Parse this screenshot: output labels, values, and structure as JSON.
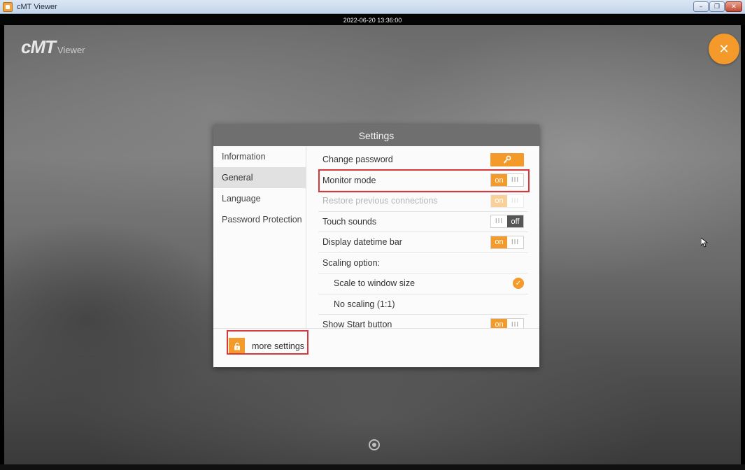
{
  "window": {
    "title": "cMT Viewer",
    "minimize_glyph": "–",
    "restore_glyph": "❐",
    "close_glyph": "✕"
  },
  "datetime_bar": {
    "text": "2022-06-20 13:36:00"
  },
  "logo": {
    "main": "cMT",
    "sub": "Viewer"
  },
  "close_fab": {
    "icon": "close-icon",
    "glyph": "✕"
  },
  "colors": {
    "accent": "#f39a2b",
    "highlight": "#d8383c",
    "dialog_header": "#6f6f6f"
  },
  "dialog": {
    "title": "Settings",
    "sidebar": [
      {
        "label": "Information",
        "active": false
      },
      {
        "label": "General",
        "active": true
      },
      {
        "label": "Language",
        "active": false
      },
      {
        "label": "Password Protection",
        "active": false
      }
    ],
    "rows": {
      "change_password": {
        "label": "Change password",
        "icon": "key-icon",
        "glyph": "🔑"
      },
      "monitor_mode": {
        "label": "Monitor mode",
        "state": "on"
      },
      "restore_connections": {
        "label": "Restore previous connections",
        "state": "on",
        "disabled": true
      },
      "touch_sounds": {
        "label": "Touch sounds",
        "state": "off"
      },
      "display_datetime_bar": {
        "label": "Display datetime bar",
        "state": "on"
      },
      "scaling_option": {
        "label": "Scaling option:"
      },
      "scale_to_window": {
        "label": "Scale to window size",
        "selected": true
      },
      "no_scaling": {
        "label": "No scaling (1:1)",
        "selected": false
      },
      "show_start_button": {
        "label": "Show Start button",
        "state": "on"
      }
    },
    "toggle_on_text": "on",
    "toggle_off_text": "off",
    "toggle_grip": "III",
    "check_glyph": "✓",
    "footer": {
      "more_settings_label": "more settings",
      "icon": "unlock-icon"
    }
  }
}
